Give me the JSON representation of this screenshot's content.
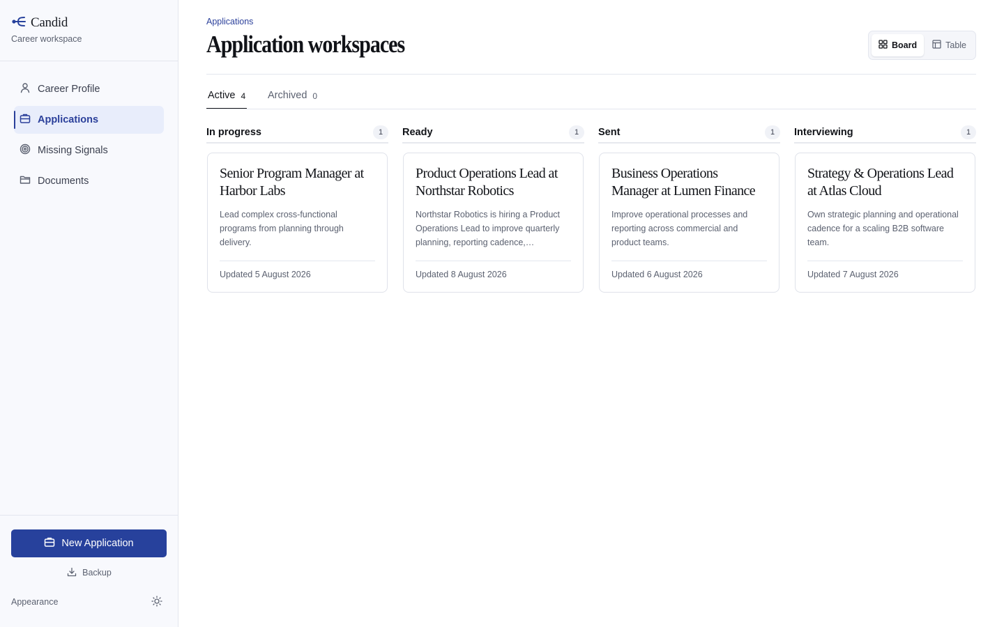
{
  "brand": {
    "name": "Candid",
    "subtitle": "Career workspace"
  },
  "sidebar": {
    "items": [
      {
        "label": "Career Profile",
        "icon": "user-icon",
        "active": false
      },
      {
        "label": "Applications",
        "icon": "briefcase-icon",
        "active": true
      },
      {
        "label": "Missing Signals",
        "icon": "target-icon",
        "active": false
      },
      {
        "label": "Documents",
        "icon": "folder-icon",
        "active": false
      }
    ],
    "new_application_label": "New Application",
    "backup_label": "Backup",
    "appearance_label": "Appearance"
  },
  "header": {
    "breadcrumb": "Applications",
    "title": "Application workspaces",
    "view_toggle": {
      "board_label": "Board",
      "table_label": "Table",
      "selected": "Board"
    }
  },
  "tabs": [
    {
      "label": "Active",
      "count": "4",
      "active": true
    },
    {
      "label": "Archived",
      "count": "0",
      "active": false
    }
  ],
  "columns": [
    {
      "title": "In progress",
      "count": "1",
      "card": {
        "title": "Senior Program Manager at Harbor Labs",
        "description": "Lead complex cross-functional programs from planning through delivery.",
        "updated": "Updated 5 August 2026"
      }
    },
    {
      "title": "Ready",
      "count": "1",
      "card": {
        "title": "Product Operations Lead at Northstar Robotics",
        "description": "Northstar Robotics is hiring a Product Operations Lead to improve quarterly planning, reporting cadence, escalations and cross-team alignment.",
        "updated": "Updated 8 August 2026"
      }
    },
    {
      "title": "Sent",
      "count": "1",
      "card": {
        "title": "Business Operations Manager at Lumen Finance",
        "description": "Improve operational processes and reporting across commercial and product teams.",
        "updated": "Updated 6 August 2026"
      }
    },
    {
      "title": "Interviewing",
      "count": "1",
      "card": {
        "title": "Strategy & Operations Lead at Atlas Cloud",
        "description": "Own strategic planning and operational cadence for a scaling B2B software team.",
        "updated": "Updated 7 August 2026"
      }
    }
  ],
  "colors": {
    "accent": "#27419c",
    "sidebar_bg": "#f8f9fd",
    "active_nav_bg": "#e8edfb"
  }
}
